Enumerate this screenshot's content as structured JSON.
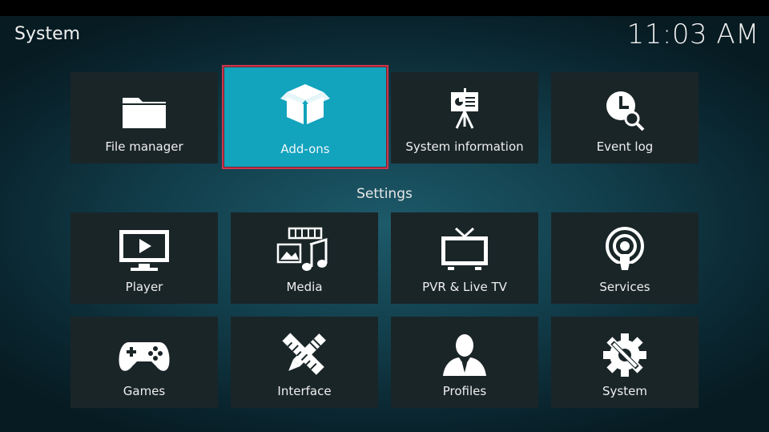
{
  "header": {
    "title": "System",
    "clock": "11:03 AM"
  },
  "top_row": [
    {
      "label": "File manager",
      "icon": "folder-icon"
    },
    {
      "label": "Add-ons",
      "icon": "box-icon"
    },
    {
      "label": "System information",
      "icon": "presentation-icon"
    },
    {
      "label": "Event log",
      "icon": "clock-search-icon"
    }
  ],
  "settings": {
    "title": "Settings",
    "items": [
      {
        "label": "Player",
        "icon": "player-icon"
      },
      {
        "label": "Media",
        "icon": "media-icon"
      },
      {
        "label": "PVR & Live TV",
        "icon": "tv-icon"
      },
      {
        "label": "Services",
        "icon": "services-icon"
      },
      {
        "label": "Games",
        "icon": "gamepad-icon"
      },
      {
        "label": "Interface",
        "icon": "interface-icon"
      },
      {
        "label": "Profiles",
        "icon": "profile-icon"
      },
      {
        "label": "System",
        "icon": "gear-wrench-icon"
      }
    ]
  },
  "colors": {
    "focus_bg": "#12a3bd",
    "focus_border": "#c8384d",
    "tile_bg": "#1a2528"
  }
}
